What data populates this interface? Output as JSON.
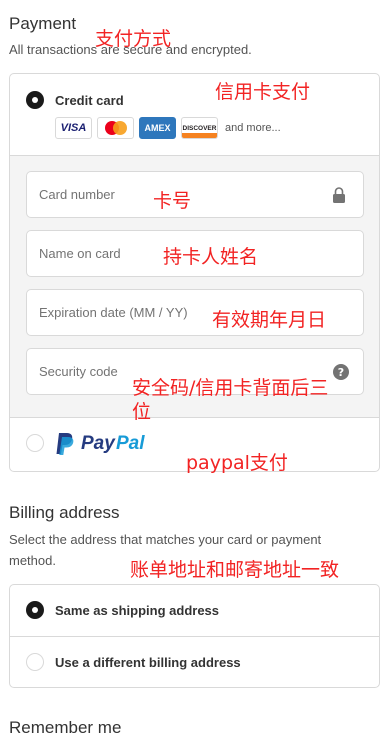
{
  "payment": {
    "title": "Payment",
    "subtitle": "All transactions are secure and encrypted.",
    "credit_card": {
      "label": "Credit card",
      "card_brands": [
        "VISA",
        "mastercard",
        "AMEX",
        "DISCOVER"
      ],
      "more_text": "and more...",
      "fields": {
        "card_number": "Card number",
        "name_on_card": "Name on card",
        "expiration": "Expiration date (MM / YY)",
        "security_code": "Security code"
      },
      "icons": {
        "card_number": "lock-icon",
        "security_code": "help-icon"
      }
    },
    "paypal": {
      "logo_text_pay": "Pay",
      "logo_text_pal": "Pal"
    }
  },
  "billing": {
    "title": "Billing address",
    "subtitle": "Select the address that matches your card or payment method.",
    "options": [
      "Same as shipping address",
      "Use a different billing address"
    ]
  },
  "remember": {
    "title": "Remember me"
  },
  "annotations": {
    "payment_method": "支付方式",
    "credit_card": "信用卡支付",
    "card_number": "卡号",
    "name_on_card": "持卡人姓名",
    "expiration": "有效期年月日",
    "security_code_line1": "安全码/信用卡背面后三",
    "security_code_line2": "位",
    "paypal": "paypal支付",
    "billing": "账单地址和邮寄地址一致"
  },
  "colors": {
    "paypal_dark": "#253b80",
    "paypal_light": "#179bd7",
    "annotation": "#f22323",
    "selected": "#1a1a1a"
  }
}
